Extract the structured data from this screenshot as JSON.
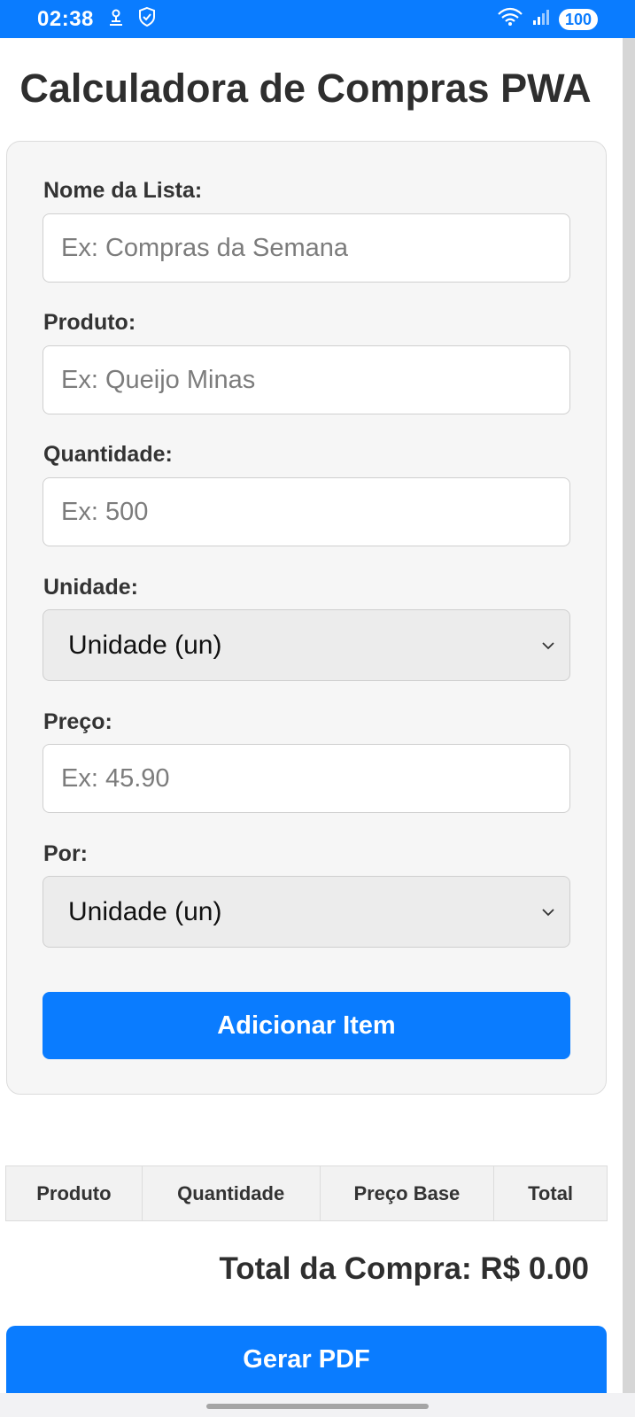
{
  "status_bar": {
    "time": "02:38",
    "battery": "100",
    "colors": {
      "background": "#0a7cff"
    }
  },
  "title": "Calculadora de Compras PWA",
  "form": {
    "list_name": {
      "label": "Nome da Lista:",
      "placeholder": "Ex: Compras da Semana",
      "value": ""
    },
    "product": {
      "label": "Produto:",
      "placeholder": "Ex: Queijo Minas",
      "value": ""
    },
    "quantity": {
      "label": "Quantidade:",
      "placeholder": "Ex: 500",
      "value": ""
    },
    "unit": {
      "label": "Unidade:",
      "selected": "Unidade (un)"
    },
    "price": {
      "label": "Preço:",
      "placeholder": "Ex: 45.90",
      "value": ""
    },
    "per": {
      "label": "Por:",
      "selected": "Unidade (un)"
    },
    "add_button": "Adicionar Item"
  },
  "table": {
    "headers": [
      "Produto",
      "Quantidade",
      "Preço Base",
      "Total"
    ],
    "rows": []
  },
  "total": "Total da Compra: R$ 0.00",
  "pdf_button": "Gerar PDF",
  "colors": {
    "accent": "#0a7cff",
    "card": "#f6f6f6"
  }
}
